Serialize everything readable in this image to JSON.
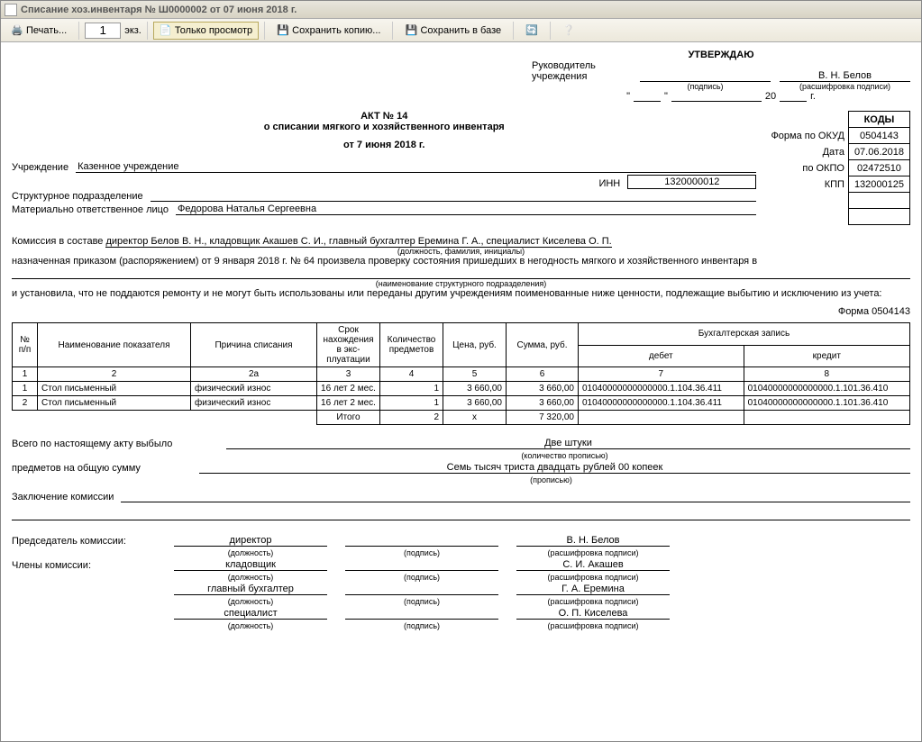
{
  "window": {
    "title": "Списание хоз.инвентаря № Ш0000002 от 07 июня 2018 г."
  },
  "toolbar": {
    "print": "Печать...",
    "copies": "1",
    "copies_label": "экз.",
    "preview": "Только просмотр",
    "save_copy": "Сохранить копию...",
    "save_db": "Сохранить в базе"
  },
  "approve": {
    "title": "УТВЕРЖДАЮ",
    "head_label": "Руководитель учреждения",
    "name": "В. Н. Белов",
    "sig_sub": "(подпись)",
    "name_sub": "(расшифровка подписи)",
    "year_suffix": "20",
    "year_g": "г."
  },
  "header": {
    "act": "АКТ № 14",
    "subtitle": "о списании мягкого и хозяйственного инвентаря",
    "date": "от 7 июня 2018 г."
  },
  "codes": {
    "header": "КОДЫ",
    "okud_label": "Форма  по ОКУД",
    "okud": "0504143",
    "date_label": "Дата",
    "date": "07.06.2018",
    "okpo_label": "по ОКПО",
    "okpo": "02472510",
    "kpp_label": "КПП",
    "kpp": "132000125"
  },
  "org": {
    "inst_label": "Учреждение",
    "inst": "Казенное учреждение",
    "inn_label": "ИНН",
    "inn": "1320000012",
    "dept_label": "Структурное подразделение",
    "resp_label": "Материально ответственное лицо",
    "resp": "Федорова Наталья Сергеевна"
  },
  "commission": {
    "prefix": "Комиссия в составе",
    "members": "директор Белов В. Н., кладовщик Акашев С. И., главный бухгалтер Еремина  Г. А., специалист Киселева О. П.",
    "sub1": "(должность, фамилия, инициалы)",
    "order_line": "назначенная приказом (распоряжением) от  9 января 2018 г.   № 64   произвела проверку состояния пришедших в негодность мягкого и хозяйственного инвентаря в",
    "sub2": "(наименование структурного подразделения)",
    "conclusion": "и установила, что не поддаются ремонту и не могут быть использованы или переданы другим учреждениям поименованные ниже ценности, подлежащие выбытию и исключению из учета:"
  },
  "form_number": "Форма 0504143",
  "table": {
    "headers": {
      "n": "№ п/п",
      "name": "Наименование показателя",
      "reason": "Причина списания",
      "duration": "Срок нахождения в экс-плуатации",
      "qty": "Количество предметов",
      "price": "Цена, руб.",
      "sum": "Сумма, руб.",
      "accounting": "Бухгалтерская запись",
      "debit": "дебет",
      "credit": "кредит"
    },
    "colnums": [
      "1",
      "2",
      "2а",
      "3",
      "4",
      "5",
      "6",
      "7",
      "8"
    ],
    "rows": [
      {
        "n": "1",
        "name": "Стол письменный",
        "reason": "физический износ",
        "dur": "16 лет 2 мес.",
        "qty": "1",
        "price": "3 660,00",
        "sum": "3 660,00",
        "debit": "01040000000000000.1.104.36.411",
        "credit": "01040000000000000.1.101.36.410"
      },
      {
        "n": "2",
        "name": "Стол письменный",
        "reason": "физический износ",
        "dur": "16 лет 2 мес.",
        "qty": "1",
        "price": "3 660,00",
        "sum": "3 660,00",
        "debit": "01040000000000000.1.104.36.411",
        "credit": "01040000000000000.1.101.36.410"
      }
    ],
    "total_label": "Итого",
    "total": {
      "qty": "2",
      "price": "х",
      "sum": "7 320,00"
    }
  },
  "summary": {
    "line1_label": "Всего по настоящему акту выбыло",
    "line1_val": "Две штуки",
    "line1_sub": "(количество прописью)",
    "line2_label": "предметов на общую сумму",
    "line2_val": "Семь тысяч триста двадцать рублей 00 копеек",
    "line2_sub": "(прописью)",
    "conclusion_label": "Заключение комиссии"
  },
  "signatures": {
    "chair_label": "Председатель комиссии:",
    "members_label": "Члены комиссии:",
    "sig_sub": "(подпись)",
    "pos_sub": "(должность)",
    "name_sub": "(расшифровка подписи)",
    "list": [
      {
        "pos": "директор",
        "name": "В. Н. Белов"
      },
      {
        "pos": "кладовщик",
        "name": "С. И. Акашев"
      },
      {
        "pos": "главный бухгалтер",
        "name": "Г. А. Еремина"
      },
      {
        "pos": "специалист",
        "name": "О. П. Киселева"
      }
    ]
  }
}
